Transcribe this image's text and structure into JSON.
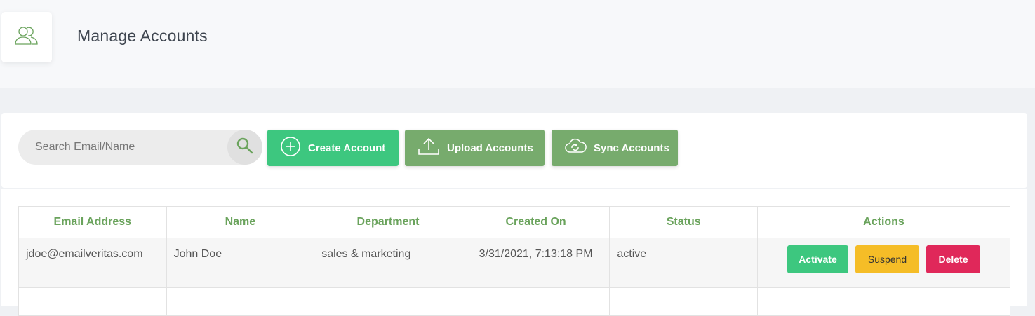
{
  "header": {
    "icon": "users-icon",
    "title": "Manage Accounts"
  },
  "toolbar": {
    "search": {
      "placeholder": "Search Email/Name",
      "value": "",
      "icon": "search-icon"
    },
    "create_label": "Create Account",
    "upload_label": "Upload Accounts",
    "sync_label": "Sync Accounts"
  },
  "table": {
    "columns": [
      "Email Address",
      "Name",
      "Department",
      "Created On",
      "Status",
      "Actions"
    ],
    "rows": [
      {
        "email": "jdoe@emailveritas.com",
        "name": "John Doe",
        "department": "sales & marketing",
        "created_on": "3/31/2021, 7:13:18 PM",
        "status": "active",
        "actions": {
          "activate": "Activate",
          "suspend": "Suspend",
          "delete": "Delete"
        }
      }
    ]
  },
  "colors": {
    "primary_green": "#3dc77f",
    "muted_green": "#77ab6d",
    "header_text_green": "#6aa35c",
    "warning_yellow": "#f5bd27",
    "danger_red": "#e0285a"
  }
}
